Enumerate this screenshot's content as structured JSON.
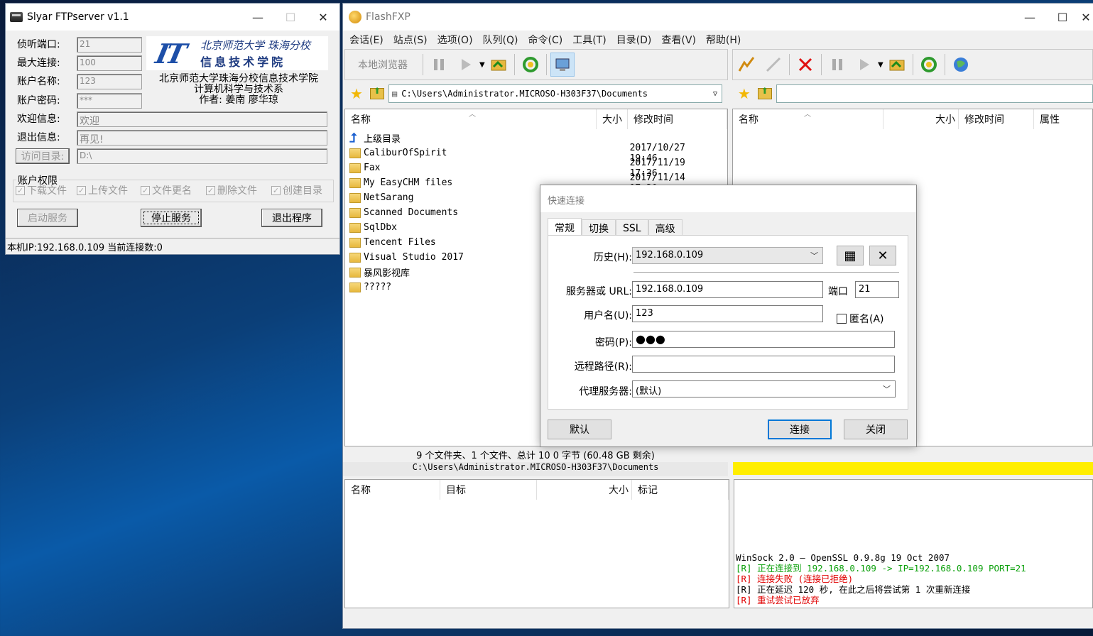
{
  "slyar": {
    "title": "Slyar FTPserver v1.1",
    "fields": [
      {
        "label": "侦听端口:",
        "value": "21"
      },
      {
        "label": "最大连接:",
        "value": "100"
      },
      {
        "label": "账户名称:",
        "value": "123"
      },
      {
        "label": "账户密码:",
        "value": "***"
      },
      {
        "label": "欢迎信息:",
        "value": "欢迎"
      },
      {
        "label": "退出信息:",
        "value": "再见!"
      }
    ],
    "visit_dir_button": "访问目录:",
    "visit_dir_value": "D:\\",
    "logo": {
      "brand": "IT",
      "line1": "北京师范大学 珠海分校",
      "line2": "信息技术学院"
    },
    "credits": [
      "北京师范大学珠海分校信息技术学院",
      "计算机科学与技术系",
      "作者: 姜南 廖华琼"
    ],
    "permissions_title": "账户权限",
    "permissions": [
      "下载文件",
      "上传文件",
      "文件更名",
      "删除文件",
      "创建目录"
    ],
    "buttons": {
      "start": "启动服务",
      "stop": "停止服务",
      "exit": "退出程序"
    },
    "status": "本机IP:192.168.0.109 当前连接数:0"
  },
  "flashfxp": {
    "title": "FlashFXP",
    "menu": [
      "会话(E)",
      "站点(S)",
      "选项(O)",
      "队列(Q)",
      "命令(C)",
      "工具(T)",
      "目录(D)",
      "查看(V)",
      "帮助(H)"
    ],
    "local_browser_label": "本地浏览器",
    "local_path": "C:\\Users\\Administrator.MICROSO-H303F37\\Documents",
    "left_columns": [
      "名称",
      "大小",
      "修改时间"
    ],
    "right_columns": [
      "名称",
      "大小",
      "修改时间",
      "属性"
    ],
    "files": [
      {
        "name": "上级目录",
        "date": "",
        "type": "up"
      },
      {
        "name": "CaliburOfSpirit",
        "date": "2017/10/27 19:46",
        "type": "folder"
      },
      {
        "name": "Fax",
        "date": "2017/11/19 17:36",
        "type": "folder"
      },
      {
        "name": "My EasyCHM files",
        "date": "2017/11/14 17:20",
        "type": "folder"
      },
      {
        "name": "NetSarang",
        "date": "",
        "type": "folder"
      },
      {
        "name": "Scanned Documents",
        "date": "",
        "type": "folder"
      },
      {
        "name": "SqlDbx",
        "date": "",
        "type": "folder"
      },
      {
        "name": "Tencent Files",
        "date": "",
        "type": "folder"
      },
      {
        "name": "Visual Studio 2017",
        "date": "",
        "type": "folder"
      },
      {
        "name": "暴风影视库",
        "date": "",
        "type": "folder"
      },
      {
        "name": "?????",
        "date": "",
        "type": "folder"
      }
    ],
    "summary": "9 个文件夹、1 个文件、总计 10 0 字节 (60.48 GB 剩余)",
    "summary_path": "C:\\Users\\Administrator.MICROSO-H303F37\\Documents",
    "queue_columns": [
      "名称",
      "目标",
      "大小",
      "标记"
    ],
    "log": [
      {
        "text": "WinSock 2.0 — OpenSSL 0.9.8g 19 Oct 2007",
        "color": "black"
      },
      {
        "text": "[R] 正在连接到 192.168.0.109 -> IP=192.168.0.109 PORT=21",
        "color": "green"
      },
      {
        "text": "[R] 连接失败 (连接已拒绝)",
        "color": "red"
      },
      {
        "text": "[R] 正在延迟 120 秒, 在此之后将尝试第 1 次重新连接",
        "color": "black"
      },
      {
        "text": "[R] 重试尝试已放弃",
        "color": "red"
      }
    ]
  },
  "quick_connect": {
    "title": "快速连接",
    "tabs": [
      "常规",
      "切换",
      "SSL",
      "高级"
    ],
    "history_label": "历史(H):",
    "history_value": "192.168.0.109",
    "server_label": "服务器或 URL:",
    "server_value": "192.168.0.109",
    "port_label": "端口",
    "port_value": "21",
    "user_label": "用户名(U):",
    "user_value": "123",
    "anonymous_label": "匿名(A)",
    "password_label": "密码(P):",
    "password_value": "●●●",
    "remote_path_label": "远程路径(R):",
    "remote_path_value": "",
    "proxy_label": "代理服务器:",
    "proxy_value": "(默认)",
    "buttons": {
      "default": "默认",
      "connect": "连接",
      "close": "关闭"
    }
  }
}
